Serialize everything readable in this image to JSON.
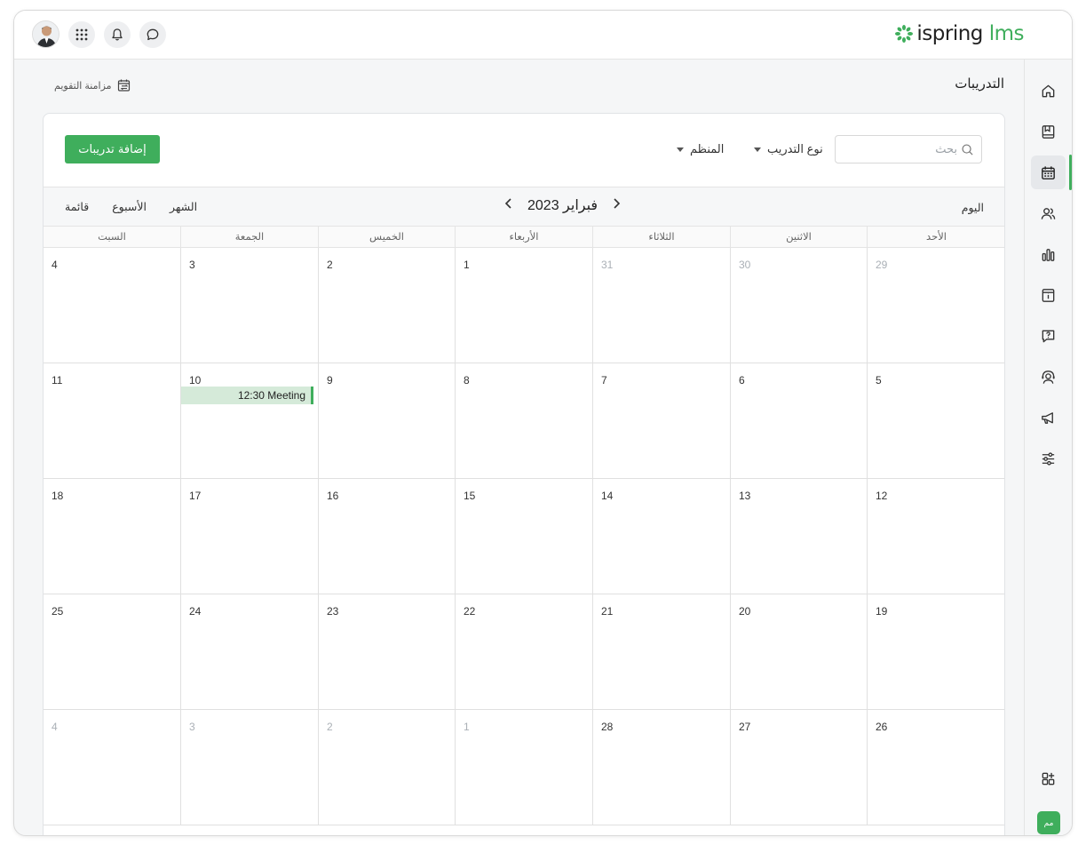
{
  "brand": {
    "logo_main": "ispring",
    "logo_accent": "lms",
    "accent_color": "#3fae5c"
  },
  "topbar": {
    "icons": [
      "apps-grid-icon",
      "bell-icon",
      "chat-icon"
    ]
  },
  "page": {
    "title": "التدريبات",
    "sync_label": "مزامنة التقويم"
  },
  "toolbar": {
    "add_button": "إضافة تدريبات",
    "search_placeholder": "بحث",
    "filters": [
      {
        "label": "نوع التدريب"
      },
      {
        "label": "المنظم"
      }
    ]
  },
  "calendar": {
    "views": [
      "قائمة",
      "الأسبوع",
      "الشهر"
    ],
    "month_label": "فبراير 2023",
    "today_label": "اليوم",
    "weekdays": [
      "السبت",
      "الجمعة",
      "الخميس",
      "الأربعاء",
      "الثلاثاء",
      "الاثنين",
      "الأحد"
    ],
    "weeks": [
      {
        "days": [
          {
            "n": "4",
            "muted": false
          },
          {
            "n": "3",
            "muted": false
          },
          {
            "n": "2",
            "muted": false
          },
          {
            "n": "1",
            "muted": false
          },
          {
            "n": "31",
            "muted": true
          },
          {
            "n": "30",
            "muted": true
          },
          {
            "n": "29",
            "muted": true
          }
        ]
      },
      {
        "days": [
          {
            "n": "11",
            "muted": false
          },
          {
            "n": "10",
            "muted": false,
            "event": "12:30 Meeting"
          },
          {
            "n": "9",
            "muted": false
          },
          {
            "n": "8",
            "muted": false
          },
          {
            "n": "7",
            "muted": false
          },
          {
            "n": "6",
            "muted": false
          },
          {
            "n": "5",
            "muted": false
          }
        ]
      },
      {
        "days": [
          {
            "n": "18",
            "muted": false
          },
          {
            "n": "17",
            "muted": false
          },
          {
            "n": "16",
            "muted": false
          },
          {
            "n": "15",
            "muted": false
          },
          {
            "n": "14",
            "muted": false
          },
          {
            "n": "13",
            "muted": false
          },
          {
            "n": "12",
            "muted": false
          }
        ]
      },
      {
        "days": [
          {
            "n": "25",
            "muted": false
          },
          {
            "n": "24",
            "muted": false
          },
          {
            "n": "23",
            "muted": false
          },
          {
            "n": "22",
            "muted": false
          },
          {
            "n": "21",
            "muted": false
          },
          {
            "n": "20",
            "muted": false
          },
          {
            "n": "19",
            "muted": false
          }
        ]
      },
      {
        "days": [
          {
            "n": "4",
            "muted": true
          },
          {
            "n": "3",
            "muted": true
          },
          {
            "n": "2",
            "muted": true
          },
          {
            "n": "1",
            "muted": true
          },
          {
            "n": "28",
            "muted": false
          },
          {
            "n": "27",
            "muted": false
          },
          {
            "n": "26",
            "muted": false
          }
        ]
      }
    ]
  },
  "sidebar": {
    "items": [
      "home-icon",
      "book-icon",
      "calendar-icon",
      "users-icon",
      "bar-chart-icon",
      "info-box-icon",
      "question-bubble-icon",
      "support-agent-icon",
      "megaphone-icon",
      "sliders-icon"
    ],
    "bottom_icon": "add-widget-icon",
    "user_initials": "مم"
  }
}
